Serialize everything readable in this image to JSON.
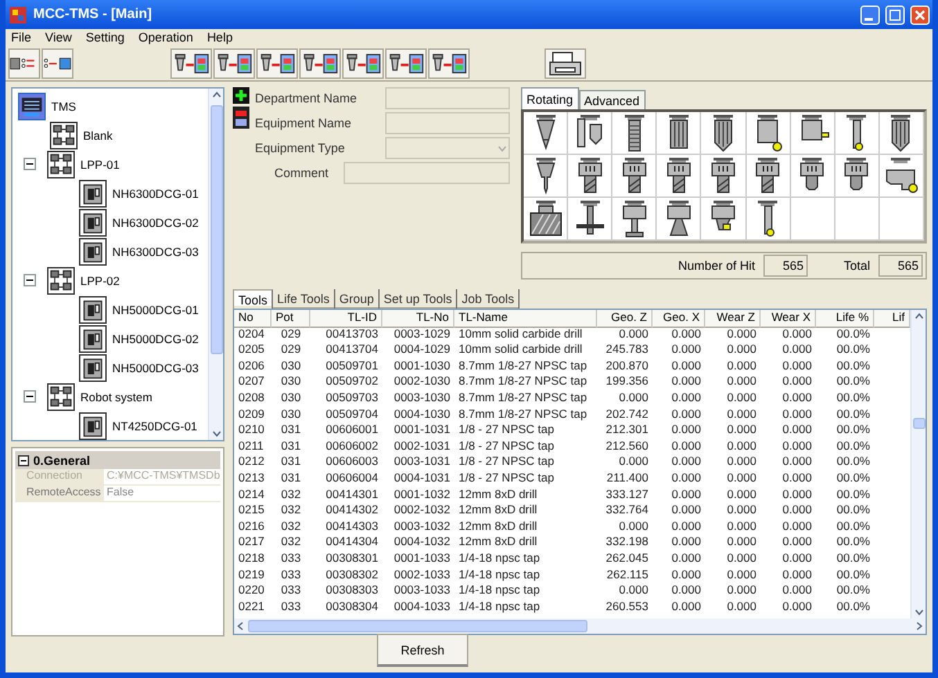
{
  "window": {
    "title": "MCC-TMS - [Main]"
  },
  "menu": [
    "File",
    "View",
    "Setting",
    "Operation",
    "Help"
  ],
  "toolbar": [
    [
      {
        "kind": "machine_list"
      },
      {
        "kind": "list_transfer"
      }
    ],
    [
      {
        "kind": "drill"
      },
      {
        "kind": "insert_drill"
      },
      {
        "kind": "pair"
      },
      {
        "kind": "probe"
      },
      {
        "kind": "boring"
      },
      {
        "kind": "holder"
      },
      {
        "kind": "chain"
      }
    ],
    [
      {
        "kind": "printer"
      }
    ]
  ],
  "tree": [
    {
      "label": "TMS",
      "kind": "root",
      "selected": true,
      "children": [
        {
          "label": "Blank",
          "kind": "system",
          "selected": false
        },
        {
          "label": "LPP-01",
          "kind": "system",
          "selected": false,
          "expanded": true,
          "children": [
            {
              "label": "NH6300DCG-01",
              "kind": "machine",
              "selected": false
            },
            {
              "label": "NH6300DCG-02",
              "kind": "machine",
              "selected": false
            },
            {
              "label": "NH6300DCG-03",
              "kind": "machine",
              "selected": false
            }
          ]
        },
        {
          "label": "LPP-02",
          "kind": "system",
          "selected": false,
          "expanded": true,
          "children": [
            {
              "label": "NH5000DCG-01",
              "kind": "machine",
              "selected": false
            },
            {
              "label": "NH5000DCG-02",
              "kind": "machine",
              "selected": false
            },
            {
              "label": "NH5000DCG-03",
              "kind": "machine",
              "selected": false
            }
          ]
        },
        {
          "label": "Robot system",
          "kind": "system",
          "selected": false,
          "expanded": true,
          "children": [
            {
              "label": "NT4250DCG-01",
              "kind": "machine",
              "selected": false
            }
          ]
        }
      ]
    }
  ],
  "properties": {
    "group": "0.General",
    "expanded": true,
    "rows": [
      {
        "name": "Connection",
        "value": "C:¥MCC-TMS¥TMSDb",
        "disabled": true
      },
      {
        "name": "RemoteAccess",
        "value": "False",
        "disabled": false
      }
    ]
  },
  "form": [
    {
      "label": "Department Name",
      "kind": "text"
    },
    {
      "label": "Equipment Name",
      "kind": "text"
    },
    {
      "label": "Equipment Type",
      "kind": "select"
    },
    {
      "label": "Comment",
      "kind": "text"
    }
  ],
  "palette": {
    "tabs": [
      {
        "label": "Rotating",
        "selected": true
      },
      {
        "label": "Advanced",
        "selected": false
      }
    ],
    "cells": [
      {
        "kind": "drill"
      },
      {
        "kind": "insert_drill"
      },
      {
        "kind": "tap"
      },
      {
        "kind": "reamer"
      },
      {
        "kind": "reamer_point"
      },
      {
        "kind": "boring"
      },
      {
        "kind": "boring_side"
      },
      {
        "kind": "boring_small"
      },
      {
        "kind": "reamer_point"
      },
      {
        "kind": "stub_drill"
      },
      {
        "kind": "endmill"
      },
      {
        "kind": "endmill"
      },
      {
        "kind": "endmill"
      },
      {
        "kind": "endmill"
      },
      {
        "kind": "endmill"
      },
      {
        "kind": "endmill_short"
      },
      {
        "kind": "endmill_short"
      },
      {
        "kind": "back_boring"
      },
      {
        "kind": "face_mill"
      },
      {
        "kind": "slot_cutter"
      },
      {
        "kind": "t_slot"
      },
      {
        "kind": "chamfer"
      },
      {
        "kind": "chamfer_insert"
      },
      {
        "kind": "boring_small"
      },
      {
        "kind": "empty"
      },
      {
        "kind": "empty"
      },
      {
        "kind": "empty"
      }
    ],
    "hit_label": "Number of Hit",
    "hit": "565",
    "total_label": "Total",
    "total": "565"
  },
  "tabs": [
    {
      "label": "Tools",
      "selected": true
    },
    {
      "label": "Life Tools",
      "selected": false
    },
    {
      "label": "Group",
      "selected": false
    },
    {
      "label": "Set up Tools",
      "selected": false
    },
    {
      "label": "Job Tools",
      "selected": false
    }
  ],
  "table": {
    "columns": [
      "No",
      "Pot",
      "TL-ID",
      "TL-No",
      "TL-Name",
      "Geo. Z",
      "Geo. X",
      "Wear Z",
      "Wear X",
      "Life %",
      "Lif"
    ],
    "rows": [
      [
        "0204",
        "029",
        "00413703",
        "0003-1029",
        "10mm solid carbide drill",
        "0.000",
        "0.000",
        "0.000",
        "0.000",
        "00.0%"
      ],
      [
        "0205",
        "029",
        "00413704",
        "0004-1029",
        "10mm solid carbide drill",
        "245.783",
        "0.000",
        "0.000",
        "0.000",
        "00.0%"
      ],
      [
        "0206",
        "030",
        "00509701",
        "0001-1030",
        "8.7mm 1/8-27 NPSC tap",
        "200.870",
        "0.000",
        "0.000",
        "0.000",
        "00.0%"
      ],
      [
        "0207",
        "030",
        "00509702",
        "0002-1030",
        "8.7mm 1/8-27 NPSC tap",
        "199.356",
        "0.000",
        "0.000",
        "0.000",
        "00.0%"
      ],
      [
        "0208",
        "030",
        "00509703",
        "0003-1030",
        "8.7mm 1/8-27 NPSC tap",
        "0.000",
        "0.000",
        "0.000",
        "0.000",
        "00.0%"
      ],
      [
        "0209",
        "030",
        "00509704",
        "0004-1030",
        "8.7mm 1/8-27 NPSC tap",
        "202.742",
        "0.000",
        "0.000",
        "0.000",
        "00.0%"
      ],
      [
        "0210",
        "031",
        "00606001",
        "0001-1031",
        "1/8 - 27 NPSC tap",
        "212.301",
        "0.000",
        "0.000",
        "0.000",
        "00.0%"
      ],
      [
        "0211",
        "031",
        "00606002",
        "0002-1031",
        "1/8 - 27 NPSC tap",
        "212.560",
        "0.000",
        "0.000",
        "0.000",
        "00.0%"
      ],
      [
        "0212",
        "031",
        "00606003",
        "0003-1031",
        "1/8 - 27 NPSC tap",
        "0.000",
        "0.000",
        "0.000",
        "0.000",
        "00.0%"
      ],
      [
        "0213",
        "031",
        "00606004",
        "0004-1031",
        "1/8 - 27 NPSC tap",
        "211.400",
        "0.000",
        "0.000",
        "0.000",
        "00.0%"
      ],
      [
        "0214",
        "032",
        "00414301",
        "0001-1032",
        "12mm 8xD drill",
        "333.127",
        "0.000",
        "0.000",
        "0.000",
        "00.0%"
      ],
      [
        "0215",
        "032",
        "00414302",
        "0002-1032",
        "12mm 8xD drill",
        "332.764",
        "0.000",
        "0.000",
        "0.000",
        "00.0%"
      ],
      [
        "0216",
        "032",
        "00414303",
        "0003-1032",
        "12mm 8xD drill",
        "0.000",
        "0.000",
        "0.000",
        "0.000",
        "00.0%"
      ],
      [
        "0217",
        "032",
        "00414304",
        "0004-1032",
        "12mm 8xD drill",
        "332.198",
        "0.000",
        "0.000",
        "0.000",
        "00.0%"
      ],
      [
        "0218",
        "033",
        "00308301",
        "0001-1033",
        "1/4-18 npsc tap",
        "262.045",
        "0.000",
        "0.000",
        "0.000",
        "00.0%"
      ],
      [
        "0219",
        "033",
        "00308302",
        "0002-1033",
        "1/4-18 npsc tap",
        "262.115",
        "0.000",
        "0.000",
        "0.000",
        "00.0%"
      ],
      [
        "0220",
        "033",
        "00308303",
        "0003-1033",
        "1/4-18 npsc tap",
        "0.000",
        "0.000",
        "0.000",
        "0.000",
        "00.0%"
      ],
      [
        "0221",
        "033",
        "00308304",
        "0004-1033",
        "1/4-18 npsc tap",
        "260.553",
        "0.000",
        "0.000",
        "0.000",
        "00.0%"
      ]
    ]
  },
  "buttons": [
    "Refresh"
  ]
}
